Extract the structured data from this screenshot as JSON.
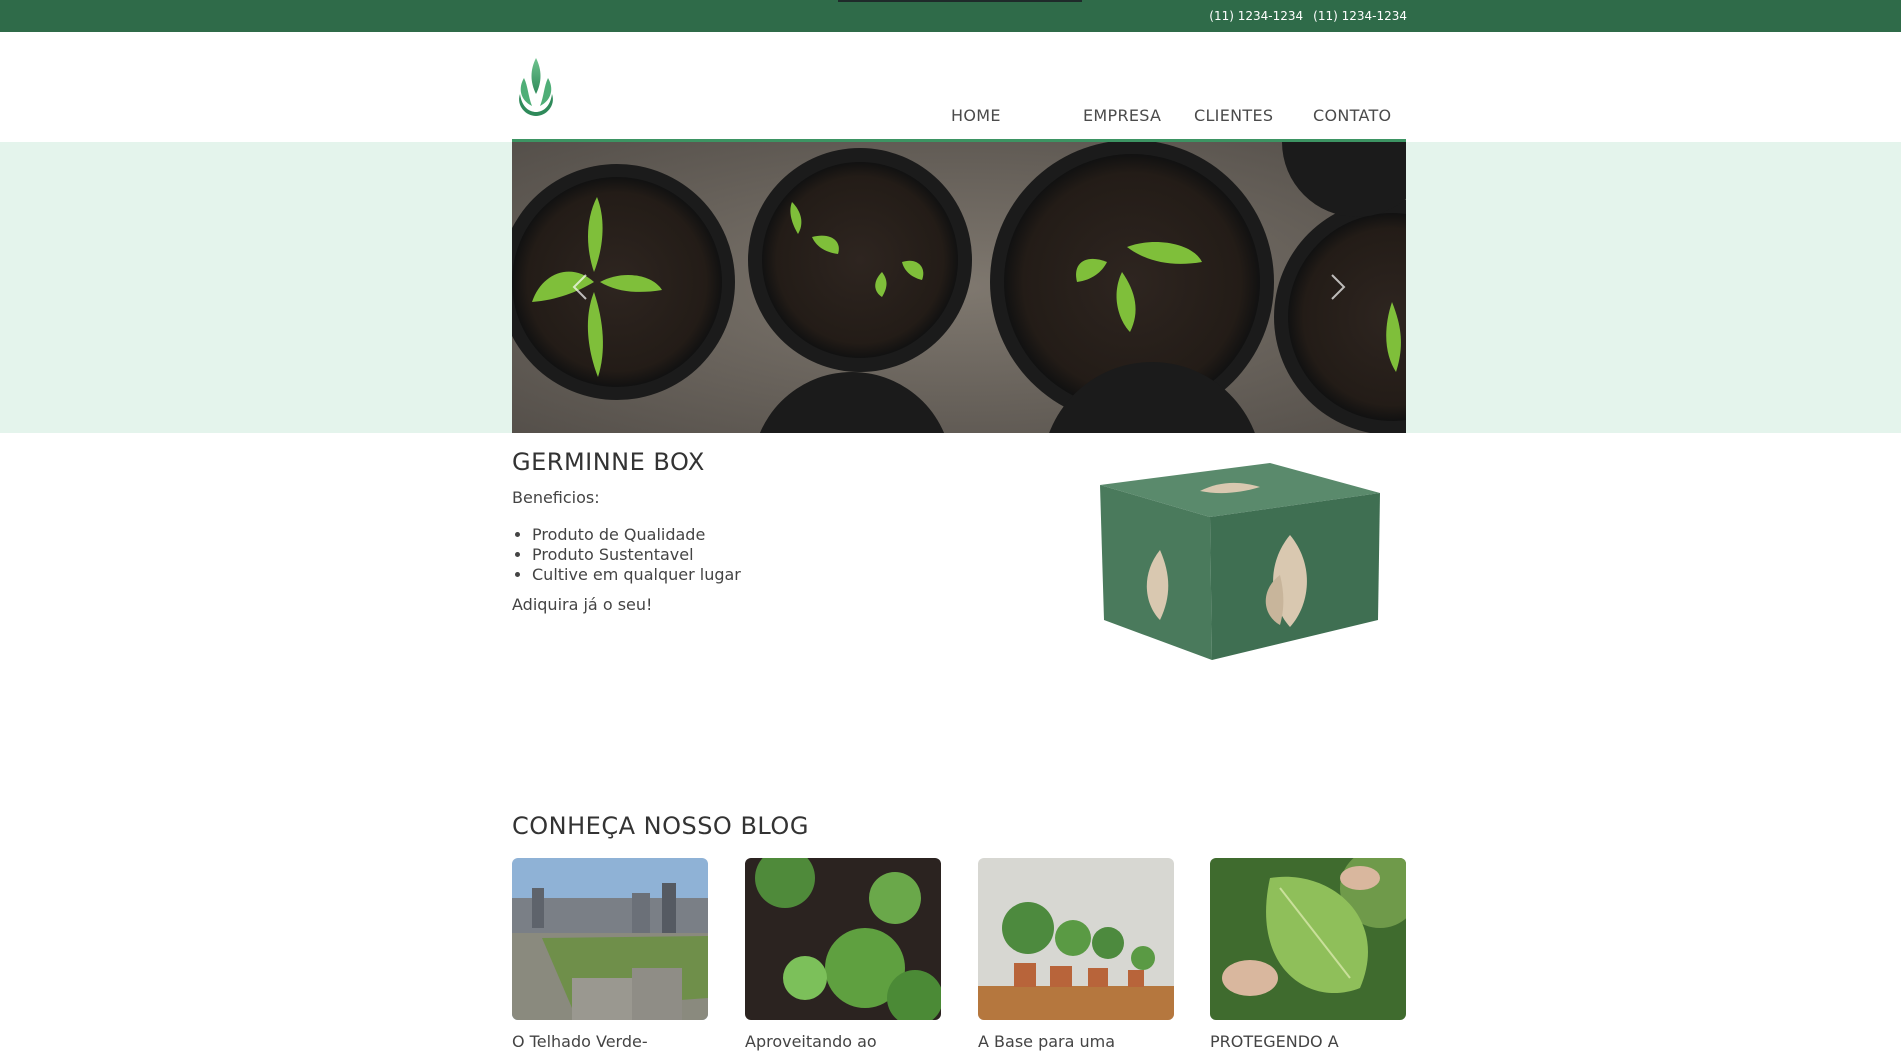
{
  "topbar": {
    "phones": [
      "(11) 1234-1234",
      "(11) 1234-1234"
    ]
  },
  "nav": {
    "items": [
      {
        "label": "HOME"
      },
      {
        "label": "EMPRESA"
      },
      {
        "label": "CLIENTES"
      },
      {
        "label": "CONTATO"
      }
    ]
  },
  "product": {
    "title": "GERMINNE BOX",
    "benefits_label": "Beneficios:",
    "benefits": [
      "Produto de Qualidade",
      "Produto Sustentavel",
      "Cultive em qualquer lugar"
    ],
    "cta": "Adiquira já o seu!"
  },
  "blog": {
    "title": "CONHEÇA NOSSO BLOG",
    "posts": [
      {
        "caption": "O Telhado Verde-"
      },
      {
        "caption": "Aproveitando ao"
      },
      {
        "caption": "A Base para uma"
      },
      {
        "caption": "PROTEGENDO A"
      }
    ]
  },
  "colors": {
    "brand_green": "#2f6b49",
    "accent_green": "#3d9463",
    "hero_band": "#e4f4ec"
  }
}
